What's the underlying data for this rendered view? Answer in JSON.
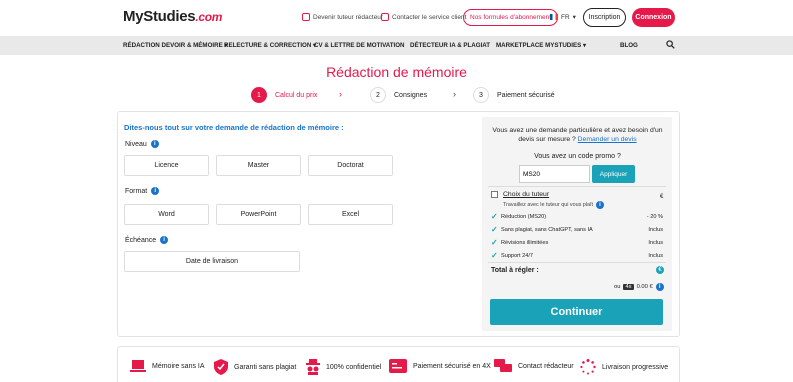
{
  "header": {
    "logo_main": "MyStudies",
    "logo_suffix": ".com",
    "link_tutor": "Devenir tuteur rédacteur",
    "link_contact": "Contacter le service client",
    "subscriptions": "Nos formules d'abonnement",
    "language": "FR",
    "signup": "Inscription",
    "login": "Connexion"
  },
  "nav": {
    "items": [
      "RÉDACTION DEVOIR & MÉMOIRE ▾",
      "RELECTURE & CORRECTION ▾",
      "CV & LETTRE DE MOTIVATION",
      "DÉTECTEUR IA & PLAGIAT",
      "MARKETPLACE MYSTUDIES ▾",
      "BLOG"
    ]
  },
  "page_title": "Rédaction de mémoire",
  "steps": [
    {
      "num": "1",
      "label": "Calcul du prix"
    },
    {
      "num": "2",
      "label": "Consignes"
    },
    {
      "num": "3",
      "label": "Paiement sécurisé"
    }
  ],
  "form": {
    "heading": "Dites-nous tout sur votre demande de rédaction de mémoire :",
    "niveau_label": "Niveau",
    "niveau_options": [
      "Licence",
      "Master",
      "Doctorat"
    ],
    "format_label": "Format",
    "format_options": [
      "Word",
      "PowerPoint",
      "Excel"
    ],
    "echeance_label": "Échéance",
    "date_button": "Date de livraison"
  },
  "summary": {
    "custom_text": "Vous avez une demande particulière et avez besoin d'un devis sur mesure ?",
    "custom_link": "Demander un devis",
    "promo_label": "Vous avez un code promo ?",
    "promo_value": "MS20",
    "promo_apply": "Appliquer",
    "tutor_choice": "Choix du tuteur",
    "tutor_sub": "Travaillez avec le tuteur qui vous plaît",
    "tutor_price": "€",
    "lines": [
      {
        "label": "Réduction (MS20)",
        "value": "- 20 %"
      },
      {
        "label": "Sans plagiat, sans ChatGPT, sans IA",
        "value": "Inclus"
      },
      {
        "label": "Révisions illimitées",
        "value": "Inclus"
      },
      {
        "label": "Support 24/7",
        "value": "Inclus"
      }
    ],
    "total_label": "Total à régler :",
    "total_value": "€",
    "pay_prefix": "ou",
    "pay_badge": "4x",
    "pay_amount": "0.00 €",
    "continue": "Continuer"
  },
  "features": [
    "Mémoire sans IA",
    "Garanti sans plagiat",
    "100% confidentiel",
    "Paiement sécurisé en 4X",
    "Contact rédacteur",
    "Livraison progressive"
  ],
  "colors": {
    "accent": "#e6194b",
    "teal": "#1aa3b8",
    "link": "#1a73c8"
  }
}
